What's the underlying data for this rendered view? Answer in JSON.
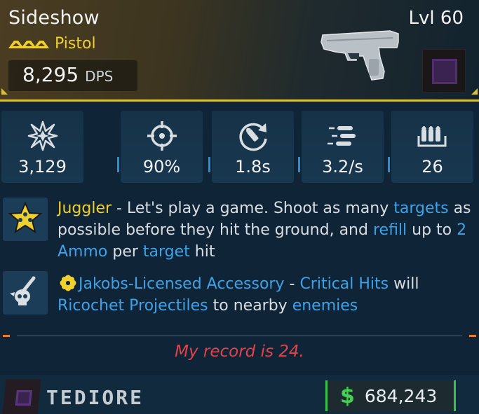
{
  "item": {
    "name": "Sideshow",
    "level": "Lvl 60",
    "weapon_type": "Pistol",
    "dps_value": "8,295",
    "dps_unit": "DPS",
    "rarity_color": "#f0d02c"
  },
  "stats": [
    {
      "icon": "damage-burst-icon",
      "value": "3,129"
    },
    {
      "icon": "crosshair-accuracy-icon",
      "value": "90%"
    },
    {
      "icon": "reload-icon",
      "value": "1.8s"
    },
    {
      "icon": "fire-rate-icon",
      "value": "3.2/s"
    },
    {
      "icon": "magazine-icon",
      "value": "26"
    }
  ],
  "perks": [
    {
      "icon": "juggler-star-icon",
      "segments": [
        {
          "t": "Juggler",
          "c": "y"
        },
        {
          "t": " - Let's play a game. Shoot as many ",
          "c": ""
        },
        {
          "t": "targets",
          "c": "b"
        },
        {
          "t": " as possible before they hit the ground, and ",
          "c": ""
        },
        {
          "t": "refill",
          "c": "b"
        },
        {
          "t": " up to ",
          "c": ""
        },
        {
          "t": "2 Ammo",
          "c": "b"
        },
        {
          "t": " per ",
          "c": ""
        },
        {
          "t": "target",
          "c": "b"
        },
        {
          "t": " hit",
          "c": ""
        }
      ]
    },
    {
      "icon": "skull-knife-icon",
      "segments": [
        {
          "t": "Jakobs-Licensed Accessory",
          "c": "b"
        },
        {
          "t": " - ",
          "c": ""
        },
        {
          "t": "Critical Hits",
          "c": "b"
        },
        {
          "t": " will ",
          "c": ""
        },
        {
          "t": "Ricochet Projectiles",
          "c": "b"
        },
        {
          "t": " to nearby ",
          "c": ""
        },
        {
          "t": "enemies",
          "c": "b"
        }
      ]
    }
  ],
  "flavor_text": "My record is 24.",
  "manufacturer": "TEDIORE",
  "value": {
    "currency_symbol": "$",
    "amount": "684,243"
  },
  "colors": {
    "legendary": "#f0d02c",
    "highlight": "#3ea2e8",
    "flavor": "#e34348",
    "money": "#44d050"
  }
}
